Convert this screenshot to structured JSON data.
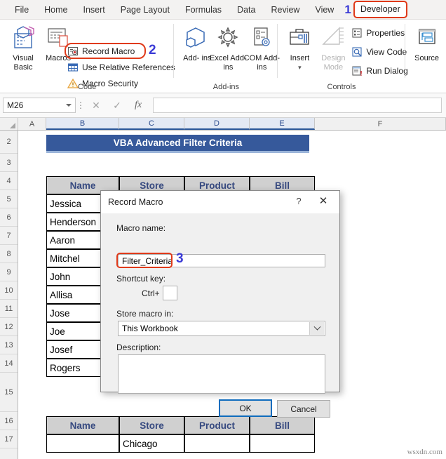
{
  "ribbon": {
    "tabs": [
      {
        "label": "File"
      },
      {
        "label": "Home"
      },
      {
        "label": "Insert"
      },
      {
        "label": "Page Layout"
      },
      {
        "label": "Formulas"
      },
      {
        "label": "Data"
      },
      {
        "label": "Review"
      },
      {
        "label": "View"
      },
      {
        "label": "Developer"
      }
    ],
    "marker_developer": "1",
    "marker_record_macro": "2",
    "groups": {
      "code": {
        "label": "Code",
        "visual_basic": "Visual\nBasic",
        "visual_basic_line1": "Visual",
        "visual_basic_line2": "Basic",
        "macros": "Macros",
        "record_macro": "Record Macro",
        "use_relative_references": "Use Relative References",
        "macro_security": "Macro Security"
      },
      "addins": {
        "label": "Add-ins",
        "addins_line1": "Add-",
        "addins_line2": "ins",
        "excel_line1": "Excel",
        "excel_line2": "Add-ins",
        "com_line1": "COM",
        "com_line2": "Add-ins"
      },
      "controls": {
        "label": "Controls",
        "insert": "Insert",
        "design_mode_line1": "Design",
        "design_mode_line2": "Mode",
        "properties": "Properties",
        "view_code": "View Code",
        "run_dialog": "Run Dialog"
      },
      "xml": {
        "source": "Source"
      }
    }
  },
  "formula_bar": {
    "name_box_value": "M26",
    "cancel_icon": "✕",
    "enter_icon": "✓",
    "function_icon": "fx",
    "formula_value": "",
    "formula_placeholder": ""
  },
  "grid": {
    "columns": [
      "A",
      "B",
      "C",
      "D",
      "E",
      "F"
    ],
    "rows": [
      "2",
      "3",
      "4",
      "5",
      "6",
      "7",
      "8",
      "9",
      "10",
      "11",
      "12",
      "13",
      "14",
      "15",
      "16",
      "17"
    ],
    "selected_column": "B",
    "banner_title": "VBA Advanced Filter Criteria",
    "table_headers": [
      "Name",
      "Store",
      "Product",
      "Bill"
    ],
    "names": [
      "Jessica",
      "Henderson",
      "Aaron",
      "Mitchel",
      "John",
      "Allisa",
      "Jose",
      "Joe",
      "Josef",
      "Rogers"
    ],
    "criteria_headers": [
      "Name",
      "Store",
      "Product",
      "Bill"
    ],
    "criteria_row": [
      "",
      "Chicago",
      "",
      ""
    ],
    "watermark": "wsxdn.com"
  },
  "dialog": {
    "title": "Record Macro",
    "help_icon": "?",
    "close_icon": "✕",
    "macro_name_label": "Macro name:",
    "macro_name_value": "Filter_Criteria",
    "marker": "3",
    "shortcut_label": "Shortcut key:",
    "ctrl_label": "Ctrl+",
    "shortcut_value": "",
    "store_label": "Store macro in:",
    "store_value": "This Workbook",
    "description_label": "Description:",
    "description_value": "",
    "ok_label": "OK",
    "cancel_label": "Cancel"
  },
  "colors": {
    "accent_blue": "#36599b",
    "marker_blue": "#3b3bd6",
    "highlight_red": "#e03a1a",
    "header_gray": "#d0d0d0"
  }
}
